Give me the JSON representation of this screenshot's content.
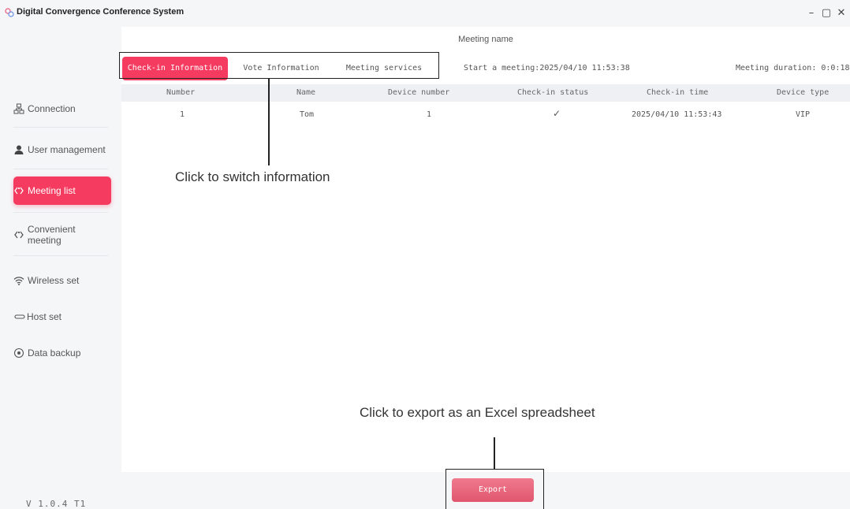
{
  "titlebar": {
    "title": "Digital Convergence Conference System",
    "logo_icon": "app-logo-icon",
    "minimize": "–",
    "maximize": "▢",
    "close": "✕"
  },
  "sidebar": {
    "items": [
      {
        "label": "Connection",
        "icon": "network-icon"
      },
      {
        "label": "User management",
        "icon": "user-icon"
      },
      {
        "label": "Meeting list",
        "icon": "meeting-icon"
      },
      {
        "label": "Convenient meeting",
        "icon": "meeting-icon"
      },
      {
        "label": "Wireless set",
        "icon": "wifi-icon"
      },
      {
        "label": "Host set",
        "icon": "host-icon"
      },
      {
        "label": "Data backup",
        "icon": "backup-icon"
      }
    ],
    "active_index": 2,
    "version": "V 1.0.4 T1"
  },
  "main": {
    "meeting_name": "Meeting name",
    "tabs": [
      {
        "label": "Check-in Information"
      },
      {
        "label": "Vote Information"
      },
      {
        "label": "Meeting services"
      }
    ],
    "start_meeting": "Start a meeting:2025/04/10 11:53:38",
    "meeting_duration": "Meeting duration: 0:0:18",
    "table": {
      "columns": [
        "Number",
        "Name",
        "Device number",
        "Check-in status",
        "Check-in time",
        "Device type"
      ],
      "rows": [
        {
          "number": "1",
          "name": "Tom",
          "device_number": "1",
          "status": "✓",
          "time": "2025/04/10 11:53:43",
          "type": "VIP"
        }
      ]
    }
  },
  "footer": {
    "export_label": "Export"
  },
  "annotations": {
    "switch_info": "Click to switch information",
    "export_info": "Click to export as an Excel spreadsheet"
  },
  "colors": {
    "accent": "#f53b5f",
    "export": "#e8647a"
  }
}
